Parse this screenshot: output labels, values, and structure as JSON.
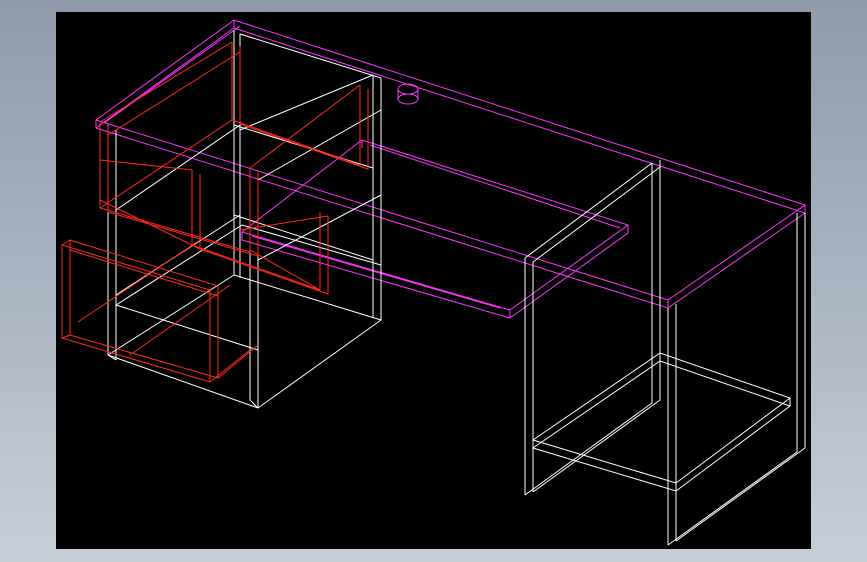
{
  "viewport": {
    "name": "cad-3d-view",
    "background": "#000000"
  },
  "colors": {
    "frame_gradient_top": "#8e9aaa",
    "frame_gradient_bottom": "#c6ced8",
    "carcass_lines": "#ffffff",
    "drawer_lines": "#ff2a1a",
    "top_panel_lines": "#ff33ff"
  },
  "model": {
    "object": "desk wireframe",
    "parts": [
      "desk-top",
      "cable-grommet",
      "keyboard-tray",
      "drawer-pedestal",
      "drawers",
      "open-side-frame",
      "lower-shelf"
    ],
    "drawer_count": 3,
    "render_mode": "wireframe"
  }
}
